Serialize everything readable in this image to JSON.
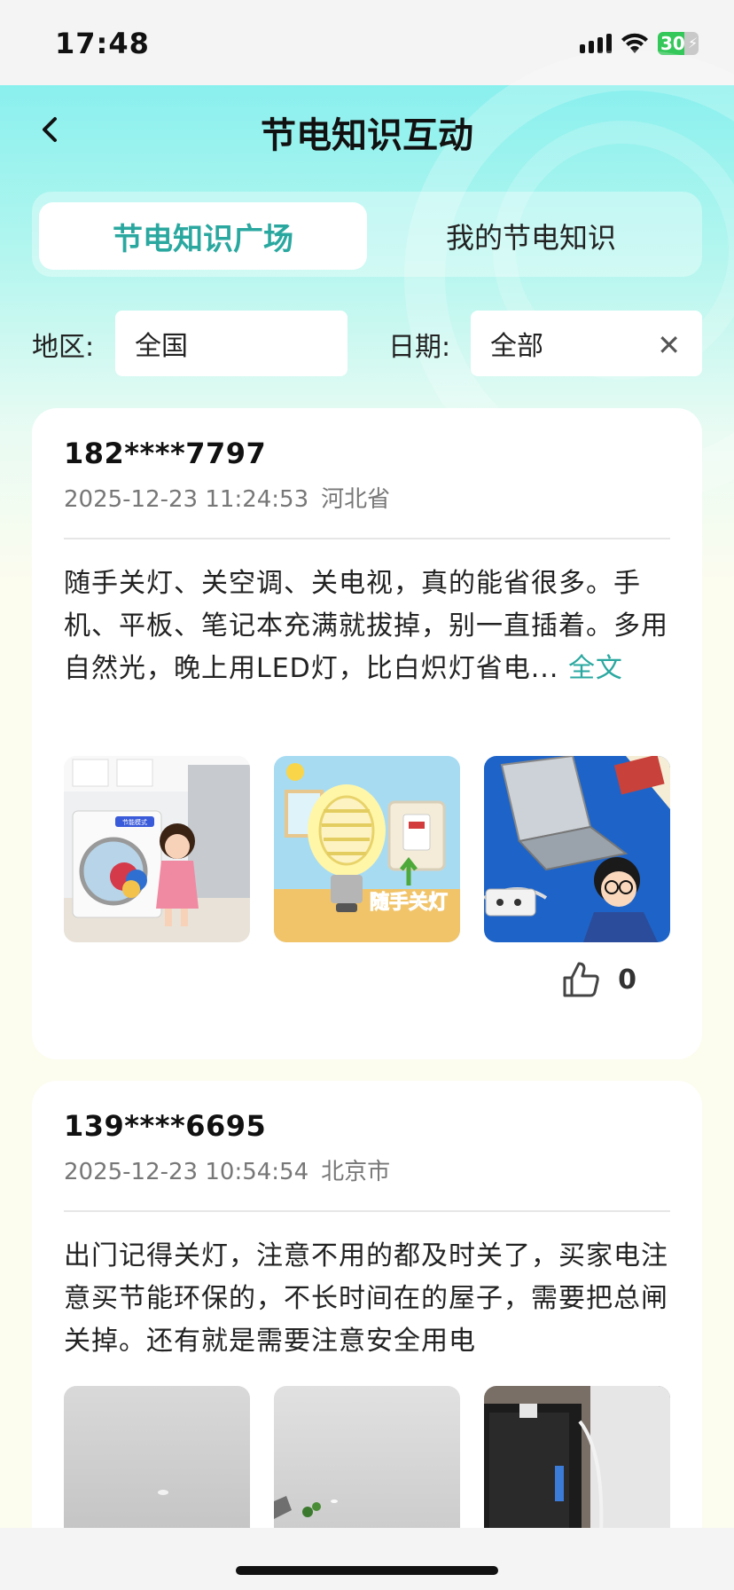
{
  "status": {
    "time": "17:48",
    "battery": "30"
  },
  "header": {
    "title": "节电知识互动"
  },
  "tabs": [
    {
      "label": "节电知识广场",
      "active": true
    },
    {
      "label": "我的节电知识",
      "active": false
    }
  ],
  "filters": {
    "region_label": "地区:",
    "region_value": "全国",
    "date_label": "日期:",
    "date_value": "全部"
  },
  "colors": {
    "accent": "#2aa8a0",
    "header_top": "#8af0ee",
    "page_bg": "#fcfcef"
  },
  "posts": [
    {
      "user": "182****7797",
      "datetime": "2025-12-23 11:24:53",
      "location": "河北省",
      "content": "随手关灯、关空调、关电视，真的能省很多。手机、平板、笔记本充满就拔掉，别一直插着。多用自然光，晚上用LED灯，比白炽灯省电...",
      "more_label": "全文",
      "images": [
        {
          "desc": "washing-machine-girl-image",
          "badge": "节能模式"
        },
        {
          "desc": "light-bulb-switch-image",
          "caption": "随手关灯"
        },
        {
          "desc": "laptop-unplug-image"
        }
      ],
      "likes": "0"
    },
    {
      "user": "139****6695",
      "datetime": "2025-12-23 10:54:54",
      "location": "北京市",
      "content": "出门记得关灯，注意不用的都及时关了，买家电注意买节能环保的，不长时间在的屋子，需要把总闸关掉。还有就是需要注意安全用电",
      "images": [
        {
          "desc": "ceiling-photo-1"
        },
        {
          "desc": "ceiling-photo-2"
        },
        {
          "desc": "computer-tower-photo"
        }
      ]
    }
  ]
}
